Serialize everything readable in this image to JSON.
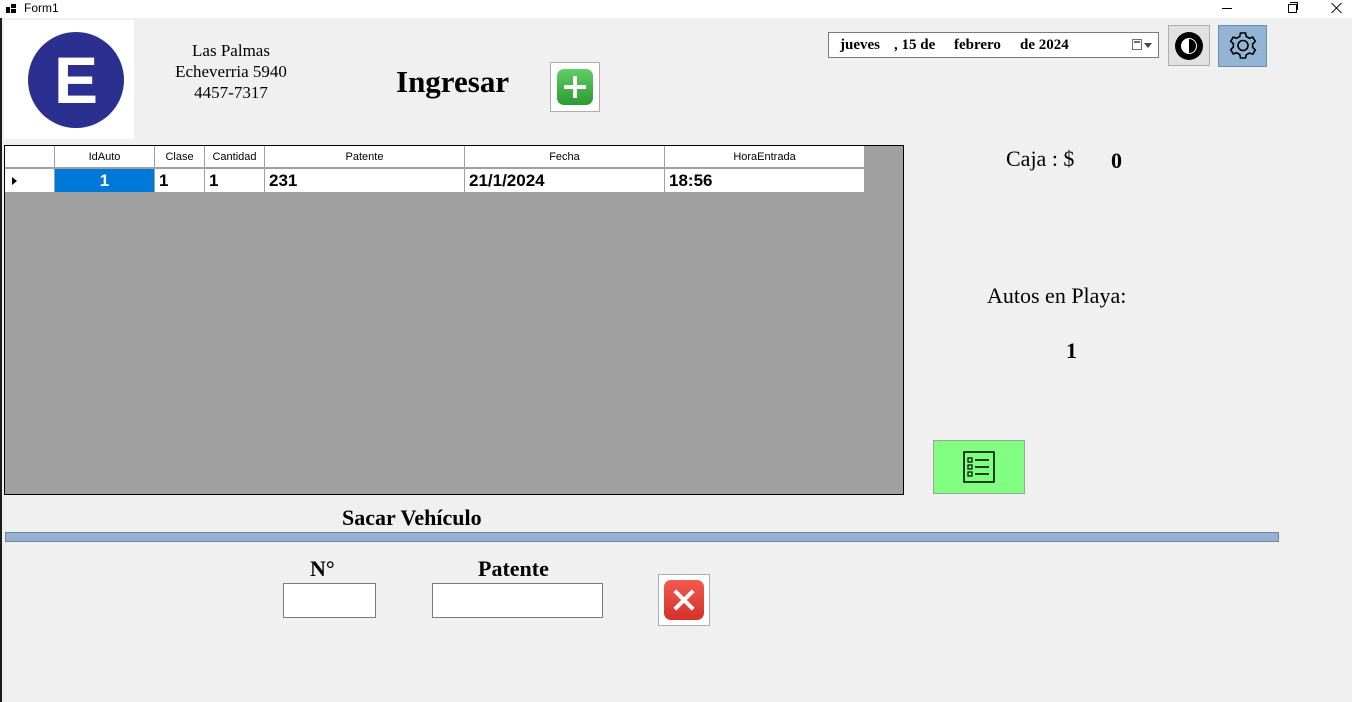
{
  "window": {
    "title": "Form1"
  },
  "business": {
    "logo_letter": "E",
    "name": "Las Palmas",
    "address": "Echeverria 5940",
    "phone": "4457-7317"
  },
  "ingresar": {
    "label": "Ingresar"
  },
  "datepicker": {
    "day": "jueves",
    "date": ", 15 de",
    "month": "febrero",
    "year": "de 2024"
  },
  "grid": {
    "columns": [
      "IdAuto",
      "Clase",
      "Cantidad",
      "Patente",
      "Fecha",
      "HoraEntrada"
    ],
    "rows": [
      {
        "IdAuto": "1",
        "Clase": "1",
        "Cantidad": "1",
        "Patente": "231",
        "Fecha": "21/1/2024",
        "HoraEntrada": "18:56"
      }
    ]
  },
  "caja": {
    "label": "Caja : $",
    "value": "0"
  },
  "autos": {
    "label": "Autos en Playa:",
    "value": "1"
  },
  "sacar": {
    "title": "Sacar Vehículo",
    "num_label": "N°",
    "patente_label": "Patente",
    "num_value": "",
    "patente_value": ""
  },
  "colors": {
    "logo": "#2b3090",
    "selected_cell": "#0078d7",
    "list_button": "#80ff80",
    "settings_button": "#93b4d4",
    "separator": "#98b1cf"
  }
}
